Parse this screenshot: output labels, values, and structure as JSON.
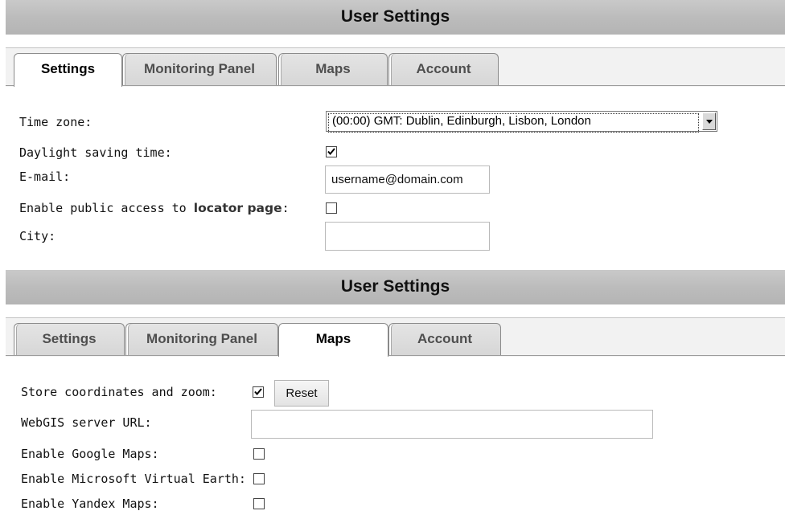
{
  "panel1": {
    "title": "User Settings",
    "tabs": [
      {
        "label": "Settings",
        "active": true
      },
      {
        "label": "Monitoring Panel",
        "active": false
      },
      {
        "label": "Maps",
        "active": false
      },
      {
        "label": "Account",
        "active": false
      }
    ],
    "fields": {
      "time_zone_label": "Time zone:",
      "time_zone_value": "(00:00) GMT: Dublin, Edinburgh, Lisbon, London",
      "dst_label": "Daylight saving time:",
      "dst_checked": true,
      "email_label": "E-mail:",
      "email_value": "username@domain.com",
      "public_prefix": "Enable public access to ",
      "public_link": "locator page",
      "public_suffix": ":",
      "public_checked": false,
      "city_label": "City:",
      "city_value": ""
    }
  },
  "panel2": {
    "title": "User Settings",
    "tabs": [
      {
        "label": "Settings",
        "active": false
      },
      {
        "label": "Monitoring Panel",
        "active": false
      },
      {
        "label": "Maps",
        "active": true
      },
      {
        "label": "Account",
        "active": false
      }
    ],
    "fields": {
      "store_label": "Store coordinates and zoom:",
      "store_checked": true,
      "reset_label": "Reset",
      "webgis_label": "WebGIS server URL:",
      "webgis_value": "",
      "google_label": "Enable Google Maps:",
      "google_checked": false,
      "msve_label": "Enable Microsoft Virtual Earth:",
      "msve_checked": false,
      "yandex_label": "Enable Yandex Maps:",
      "yandex_checked": false
    }
  },
  "icons": {
    "check": "check-icon",
    "dropdown": "chevron-down-icon"
  }
}
